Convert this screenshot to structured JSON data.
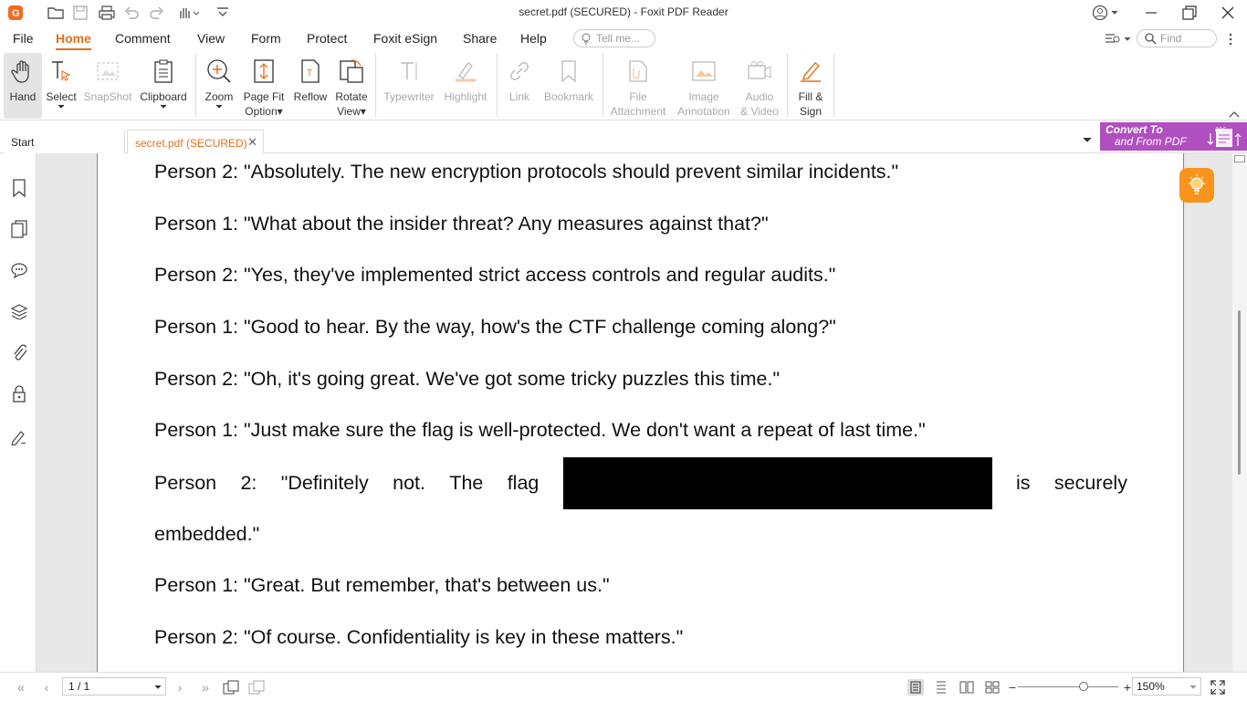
{
  "window": {
    "title": "secret.pdf (SECURED) - Foxit PDF Reader"
  },
  "menu": {
    "items": [
      "File",
      "Home",
      "Comment",
      "View",
      "Form",
      "Protect",
      "Foxit eSign",
      "Share",
      "Help"
    ],
    "active": "Home",
    "tell_me_placeholder": "Tell me...",
    "find_placeholder": "Find"
  },
  "ribbon": {
    "hand": "Hand",
    "select": "Select",
    "snapshot": "SnapShot",
    "clipboard": "Clipboard",
    "zoom": "Zoom",
    "page_fit_1": "Page Fit",
    "page_fit_2": "Option",
    "reflow": "Reflow",
    "rotate_1": "Rotate",
    "rotate_2": "View",
    "typewriter": "Typewriter",
    "highlight": "Highlight",
    "link": "Link",
    "bookmark": "Bookmark",
    "file_att_1": "File",
    "file_att_2": "Attachment",
    "image_ann_1": "Image",
    "image_ann_2": "Annotation",
    "audio_1": "Audio",
    "audio_2": "& Video",
    "fill_1": "Fill &",
    "fill_2": "Sign"
  },
  "tabs": {
    "start": "Start",
    "doc": "secret.pdf (SECURED)"
  },
  "convert_banner": {
    "line1": "Convert To",
    "line2": "and From PDF",
    "badge": "PDF"
  },
  "document": {
    "lines": [
      "Person 2: \"Absolutely. The new encryption protocols should prevent similar incidents.\"",
      "Person 1: \"What about the insider threat? Any measures against that?\"",
      "Person 2: \"Yes, they've implemented strict access controls and regular audits.\"",
      "Person 1: \"Good to hear. By the way, how's the CTF challenge coming along?\"",
      "Person 2: \"Oh, it's going great. We've got some tricky puzzles this time.\"",
      "Person 1: \"Just make sure the flag is well-protected. We don't want a repeat of last time.\""
    ],
    "redacted_line_words": [
      "Person",
      "2:",
      "\"Definitely",
      "not.",
      "The",
      "flag"
    ],
    "redacted_line_tail_words": [
      "is",
      "securely"
    ],
    "redacted_line_end": "embedded.\"",
    "lines_after": [
      "Person 1: \"Great. But remember, that's between us.\"",
      "Person 2: \"Of course. Confidentiality is key in these matters.\""
    ]
  },
  "status": {
    "page": "1 / 1",
    "zoom": "150%",
    "zoom_level": 0.65
  }
}
